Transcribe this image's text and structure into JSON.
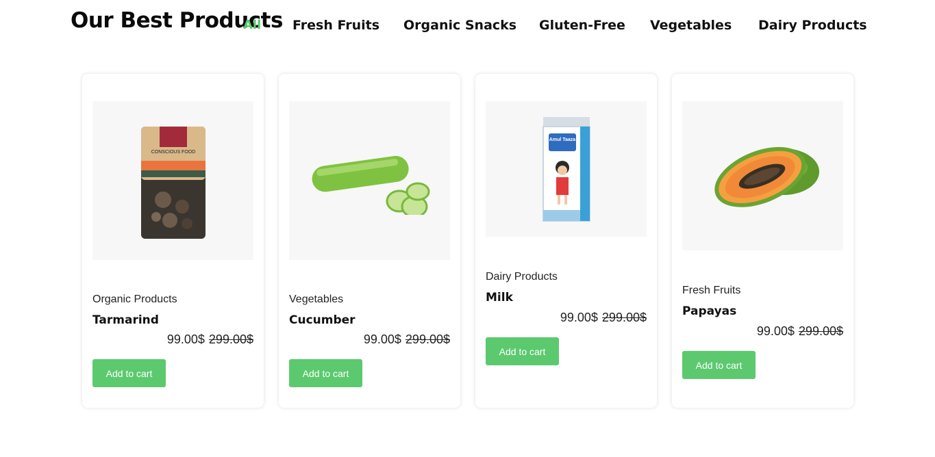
{
  "header": {
    "title": "Our Best Products",
    "tabs": [
      "All",
      "Fresh Fruits",
      "Organic Snacks",
      "Gluten-Free",
      "Vegetables",
      "Dairy Products"
    ],
    "active_tab": "All"
  },
  "colors": {
    "accent": "#5cc96f",
    "text": "#111111",
    "background": "#ffffff"
  },
  "products": [
    {
      "category": "Organic Products",
      "name": "Tarmarind",
      "price": "99.00$",
      "old_price": "299.00$",
      "button": "Add to cart",
      "image": "tamarind-pack-image",
      "pack_brand": "CONSCIOUS FOOD"
    },
    {
      "category": "Vegetables",
      "name": "Cucumber",
      "price": "99.00$",
      "old_price": "299.00$",
      "button": "Add to cart",
      "image": "cucumber-image"
    },
    {
      "category": "Dairy Products",
      "name": "Milk",
      "price": "99.00$",
      "old_price": "299.00$",
      "button": "Add to cart",
      "image": "milk-carton-image",
      "pack_brand": "Amul Taaza"
    },
    {
      "category": "Fresh Fruits",
      "name": "Papayas",
      "price": "99.00$",
      "old_price": "299.00$",
      "button": "Add to cart",
      "image": "papaya-image"
    }
  ]
}
